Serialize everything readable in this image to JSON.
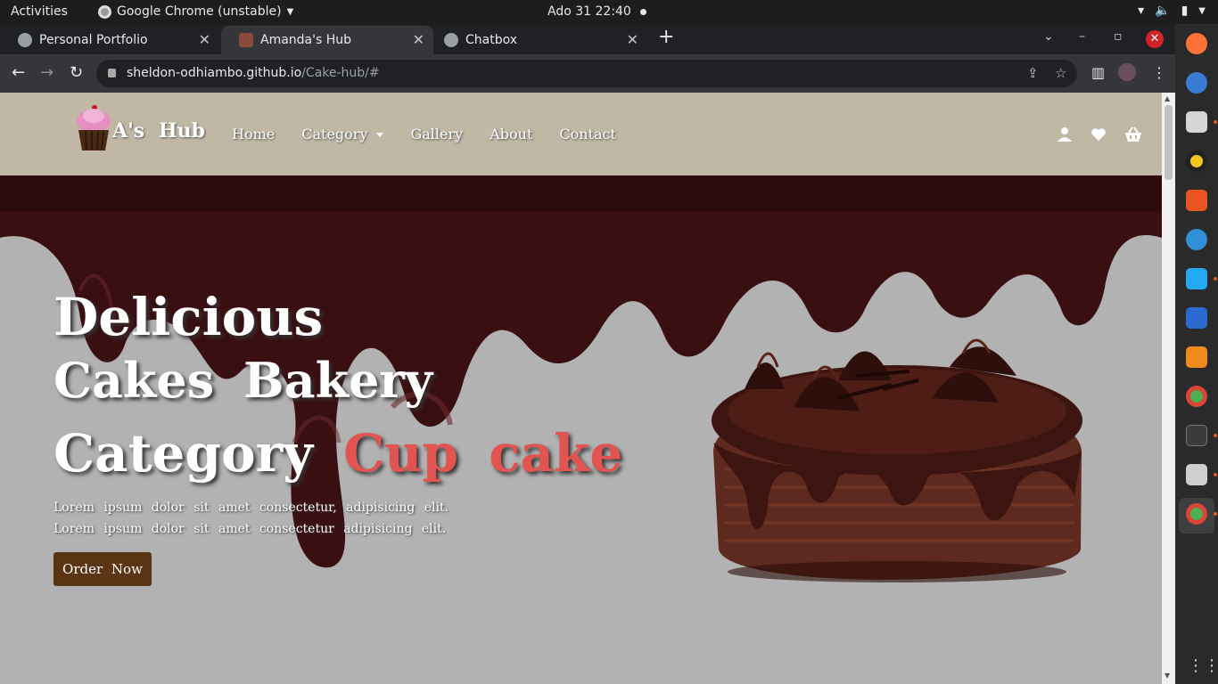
{
  "system_bar": {
    "activities": "Activities",
    "app_name": "Google Chrome (unstable)",
    "clock": "Ado 31  22:40"
  },
  "browser": {
    "tabs": [
      {
        "title": "Personal Portfolio"
      },
      {
        "title": "Amanda's Hub"
      },
      {
        "title": "Chatbox"
      }
    ],
    "url_host": "sheldon-odhiambo.github.io",
    "url_path": "/Cake-hub/#"
  },
  "site": {
    "brand": "A's Hub",
    "nav": {
      "home": "Home",
      "category": "Category",
      "gallery": "Gallery",
      "about": "About",
      "contact": "Contact"
    },
    "hero": {
      "line1": "Delicious",
      "line2": "Cakes Bakery",
      "line3_white": "Category",
      "line3_red_1": "Cup",
      "line3_red_2": "cake",
      "text_line1": "Lorem ipsum dolor sit amet consectetur, adipisicing elit.",
      "text_line2": "Lorem ipsum dolor sit amet consectetur adipisicing elit.",
      "cta": "Order Now"
    }
  },
  "colors": {
    "header_bg": "#c0b8a5",
    "hero_bg": "#b2b2b2",
    "chocolate": "#3a0f12",
    "accent_red": "#e2544f",
    "button_brown": "#5a3413"
  },
  "icons": {
    "user": "user-icon",
    "heart": "heart-icon",
    "basket": "basket-icon"
  }
}
